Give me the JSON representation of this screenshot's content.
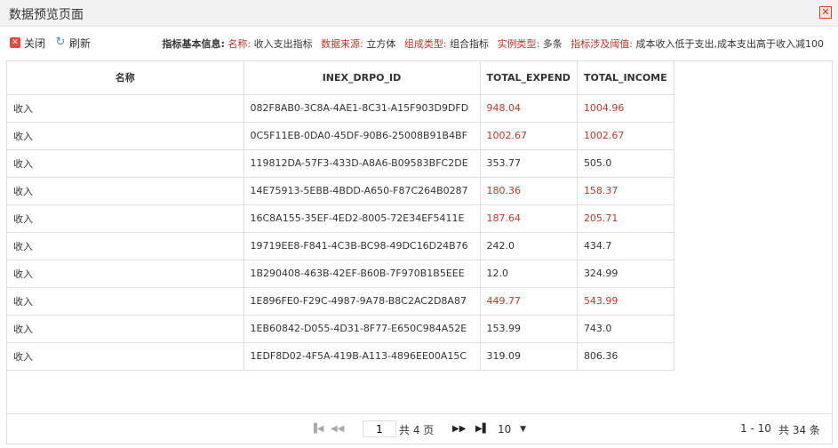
{
  "window": {
    "title": "数据预览页面",
    "close_glyph": "✕"
  },
  "toolbar": {
    "close_label": "关闭",
    "refresh_label": "刷新",
    "info_title": "指标基本信息:",
    "info": [
      {
        "key": "名称:",
        "value": "收入支出指标"
      },
      {
        "key": "数据来源:",
        "value": "立方体"
      },
      {
        "key": "组成类型:",
        "value": "组合指标"
      },
      {
        "key": "实例类型:",
        "value": "多条"
      },
      {
        "key": "指标涉及阈值:",
        "value": "成本收入低于支出,成本支出高于收入减100"
      }
    ]
  },
  "table": {
    "columns": [
      "名称",
      "INEX_DRPO_ID",
      "TOTAL_EXPEND",
      "TOTAL_INCOME"
    ],
    "rows": [
      {
        "name": "收入",
        "id": "082F8AB0-3C8A-4AE1-8C31-A15F903D9DFD",
        "expend": "948.04",
        "income": "1004.96",
        "highlight": true
      },
      {
        "name": "收入",
        "id": "0C5F11EB-0DA0-45DF-90B6-25008B91B4BF",
        "expend": "1002.67",
        "income": "1002.67",
        "highlight": true
      },
      {
        "name": "收入",
        "id": "119812DA-57F3-433D-A8A6-B09583BFC2DE",
        "expend": "353.77",
        "income": "505.0",
        "highlight": false
      },
      {
        "name": "收入",
        "id": "14E75913-5EBB-4BDD-A650-F87C264B0287",
        "expend": "180.36",
        "income": "158.37",
        "highlight": true
      },
      {
        "name": "收入",
        "id": "16C8A155-35EF-4ED2-8005-72E34EF5411E",
        "expend": "187.64",
        "income": "205.71",
        "highlight": true
      },
      {
        "name": "收入",
        "id": "19719EE8-F841-4C3B-BC98-49DC16D24B76",
        "expend": "242.0",
        "income": "434.7",
        "highlight": false
      },
      {
        "name": "收入",
        "id": "1B290408-463B-42EF-B60B-7F970B1B5EEE",
        "expend": "12.0",
        "income": "324.99",
        "highlight": false
      },
      {
        "name": "收入",
        "id": "1E896FE0-F29C-4987-9A78-B8C2AC2D8A87",
        "expend": "449.77",
        "income": "543.99",
        "highlight": true
      },
      {
        "name": "收入",
        "id": "1EB60842-D055-4D31-8F77-E650C984A52E",
        "expend": "153.99",
        "income": "743.0",
        "highlight": false
      },
      {
        "name": "收入",
        "id": "1EDF8D02-4F5A-419B-A113-4896EE00A15C",
        "expend": "319.09",
        "income": "806.36",
        "highlight": false
      }
    ]
  },
  "pager": {
    "current_page": "1",
    "total_pages_label": "共 4 页",
    "page_size": "10",
    "range_label": "1 - 10",
    "total_label": "共 34 条"
  },
  "colors": {
    "alert": "#c0392b",
    "border": "#e0e0e0"
  }
}
